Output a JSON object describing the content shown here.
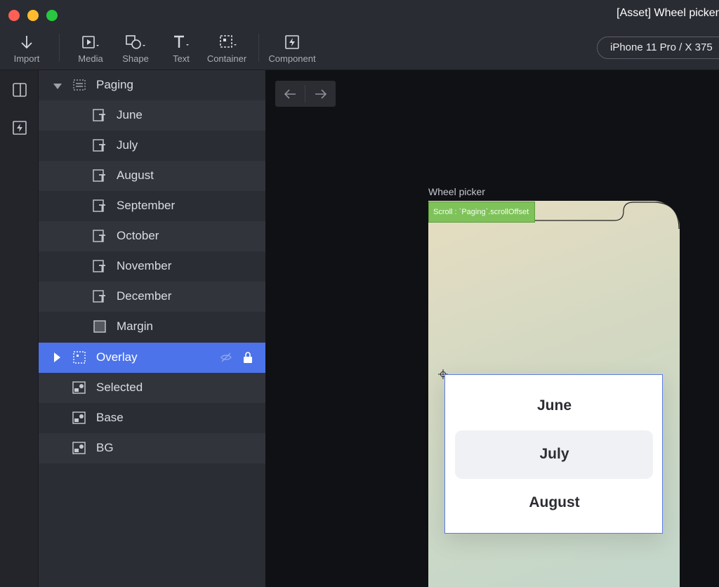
{
  "window": {
    "title": "[Asset] Wheel picker"
  },
  "toolbar": {
    "import": "Import",
    "media": "Media",
    "shape": "Shape",
    "text": "Text",
    "container": "Container",
    "component": "Component",
    "device": "iPhone 11 Pro / X  375"
  },
  "layers": {
    "paging": "Paging",
    "children": [
      "June",
      "July",
      "August",
      "September",
      "October",
      "November",
      "December"
    ],
    "margin": "Margin",
    "overlay": "Overlay",
    "selected": "Selected",
    "base": "Base",
    "bg": "BG"
  },
  "canvas": {
    "frame_label": "Wheel picker",
    "scroll_tag": "Scroll : `Paging`.scrollOffset",
    "picker": [
      "June",
      "July",
      "August"
    ]
  },
  "colors": {
    "selection": "#4c73e9",
    "scroll_tag": "#7fc25a",
    "card_border": "#5a7de6"
  }
}
